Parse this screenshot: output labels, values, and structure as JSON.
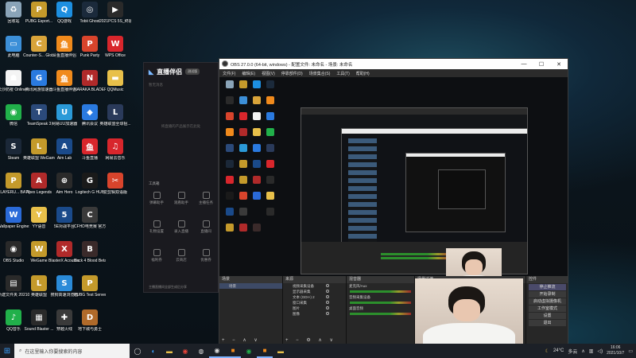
{
  "desktop": {
    "icons": [
      {
        "label": "回收站",
        "icon": "recycle-bin-icon",
        "color": "#8aa4b8",
        "glyph": "♻"
      },
      {
        "label": "PUBG Esport...",
        "icon": "pubg-esports-icon",
        "color": "#c49a2b",
        "glyph": "P"
      },
      {
        "label": "QQ游戏",
        "icon": "qq-game-icon",
        "color": "#1d8fe0",
        "glyph": "Q"
      },
      {
        "label": "Tobii Ghost",
        "icon": "tobii-ghost-icon",
        "color": "#1b2a3b",
        "glyph": "◎"
      },
      {
        "label": "2021PCS 5S_终极赛...",
        "icon": "video-file-icon",
        "color": "#2a2a2a",
        "glyph": "▶"
      },
      {
        "label": "此电脑",
        "icon": "this-pc-icon",
        "color": "#3c8fd8",
        "glyph": "▭"
      },
      {
        "label": "Counter-S... Global Off...",
        "icon": "csgo-icon",
        "color": "#d9a43a",
        "glyph": "C"
      },
      {
        "label": "斗鱼直播伴侣",
        "icon": "douyu-icon",
        "color": "#f08a1c",
        "glyph": "鱼"
      },
      {
        "label": "Punk Party",
        "icon": "punk-party-icon",
        "color": "#d8442c",
        "glyph": "P"
      },
      {
        "label": "WPS Office",
        "icon": "wps-office-icon",
        "color": "#d8262c",
        "glyph": "W"
      },
      {
        "label": "长沙防疫 Online...",
        "icon": "runner-icon",
        "color": "#f4f4f4",
        "glyph": "☗"
      },
      {
        "label": "腾讯网游加速器",
        "icon": "tencent-accelerator-icon",
        "color": "#2a7ae0",
        "glyph": "G"
      },
      {
        "label": "斗鱼直播伴侣",
        "icon": "douyu-2-icon",
        "color": "#f08a1c",
        "glyph": "鱼"
      },
      {
        "label": "NARAKA BLADEPOI...",
        "icon": "naraka-icon",
        "color": "#b02a2a",
        "glyph": "N"
      },
      {
        "label": "QQMusic",
        "icon": "folder-icon",
        "color": "#e8c04a",
        "glyph": "▬"
      },
      {
        "label": "微信",
        "icon": "wechat-icon",
        "color": "#21b04a",
        "glyph": "◉"
      },
      {
        "label": "TeamSpeak 3",
        "icon": "teamspeak-icon",
        "color": "#2b4a7a",
        "glyph": "T"
      },
      {
        "label": "网易UU加速器",
        "icon": "uu-accelerator-icon",
        "color": "#2b9ad8",
        "glyph": "U"
      },
      {
        "label": "腾讯会议",
        "icon": "tencent-meeting-icon",
        "color": "#2a7ae0",
        "glyph": "◆"
      },
      {
        "label": "英雄联盟全球狙...",
        "icon": "league-icon",
        "color": "#2a3a5a",
        "glyph": "L"
      },
      {
        "label": "Steam",
        "icon": "steam-icon",
        "color": "#1b2838",
        "glyph": "S"
      },
      {
        "label": "英雄联盟 WeGame版",
        "icon": "wegame-lol-icon",
        "color": "#c49a2b",
        "glyph": "L"
      },
      {
        "label": "Aim Lab",
        "icon": "aim-lab-icon",
        "color": "#1a4a8a",
        "glyph": "A"
      },
      {
        "label": "斗鱼直播",
        "icon": "douyu-live-icon",
        "color": "#d8262c",
        "glyph": "鱼"
      },
      {
        "label": "网易云音乐",
        "icon": "netease-music-icon",
        "color": "#d8262c",
        "glyph": "♫"
      },
      {
        "label": "PLAYERU... BATTLEGR...",
        "icon": "pubg-icon",
        "color": "#c49a2b",
        "glyph": "P"
      },
      {
        "label": "Apex Legends",
        "icon": "apex-icon",
        "color": "#b02a2a",
        "glyph": "A"
      },
      {
        "label": "Aim Hero",
        "icon": "aim-hero-icon",
        "color": "#2a2a2a",
        "glyph": "⊕"
      },
      {
        "label": "Logitech G HUB",
        "icon": "logitech-icon",
        "color": "#1a1a1a",
        "glyph": "G"
      },
      {
        "label": "爱剪辑双语版",
        "icon": "video-editor-icon",
        "color": "#d8442c",
        "glyph": "✂"
      },
      {
        "label": "Wallpaper Engine:...",
        "icon": "wallpaper-engine-icon",
        "color": "#2a6ad8",
        "glyph": "W"
      },
      {
        "label": "YY语音",
        "icon": "yy-icon",
        "color": "#e8c04a",
        "glyph": "Y"
      },
      {
        "label": "5E对战平台",
        "icon": "5e-icon",
        "color": "#1a4a8a",
        "glyph": "5"
      },
      {
        "label": "CFHD电竞赛 官方版",
        "icon": "cfhd-icon",
        "color": "#3a3a3a",
        "glyph": "C"
      },
      {
        "label": "",
        "icon": "blank-icon",
        "color": "rgba(0,0,0,0)",
        "glyph": ""
      },
      {
        "label": "OBS Studio",
        "icon": "obs-icon",
        "color": "#2a2a2a",
        "glyph": "◉"
      },
      {
        "label": "WeGame",
        "icon": "wegame-icon",
        "color": "#c49a2b",
        "glyph": "W"
      },
      {
        "label": "BlasterX Acoustic...",
        "icon": "blasterx-icon",
        "color": "#b02a2a",
        "glyph": "X"
      },
      {
        "label": "Back 4 Blood Beta",
        "icon": "back4blood-icon",
        "color": "#3a2a2a",
        "glyph": "B"
      },
      {
        "label": "",
        "icon": "blank-2-icon",
        "color": "rgba(0,0,0,0)",
        "glyph": ""
      },
      {
        "label": "新建文件夹 2021031...",
        "icon": "new-folder-icon",
        "color": "#2a2a2a",
        "glyph": "▤"
      },
      {
        "label": "英雄联盟",
        "icon": "lol-icon",
        "color": "#c49a2b",
        "glyph": "L"
      },
      {
        "label": "搜狗高速浏览器",
        "icon": "sogou-browser-icon",
        "color": "#2a8ad8",
        "glyph": "S"
      },
      {
        "label": "PUBG Test Server",
        "icon": "pubg-test-icon",
        "color": "#c49a2b",
        "glyph": "P"
      },
      {
        "label": "",
        "icon": "blank-3-icon",
        "color": "rgba(0,0,0,0)",
        "glyph": ""
      },
      {
        "label": "QQ音乐",
        "icon": "qq-music-icon",
        "color": "#21b04a",
        "glyph": "♪"
      },
      {
        "label": "Sound Blaster ...",
        "icon": "sound-blaster-icon",
        "color": "#2a2a2a",
        "glyph": "▦"
      },
      {
        "label": "穿越火线",
        "icon": "crossfire-icon",
        "color": "#3a3a3a",
        "glyph": "✚"
      },
      {
        "label": "地下城与勇士",
        "icon": "dnf-icon",
        "color": "#b06a2a",
        "glyph": "D"
      }
    ]
  },
  "obs": {
    "title": "OBS 27.0.0 (64-bit, windows) - 配置文件: 未命名 - 场景: 未命名",
    "menu": [
      "文件(F)",
      "编辑(E)",
      "视图(V)",
      "停靠部件(D)",
      "场景集合(S)",
      "工具(T)",
      "帮助(H)"
    ],
    "docks": {
      "scenes_header": "场景",
      "scene_items": [
        "场景"
      ],
      "sources_header": "来源",
      "source_items": [
        "视频采集设备",
        "显示器采集",
        "文本 (GDI+) 2",
        "窗口采集",
        "图片",
        "图像"
      ],
      "mixer_header": "混音器",
      "mixer_items": [
        "麦克风/Aux",
        "音频采集设备",
        "桌面音频"
      ],
      "transitions_header": "场景过渡",
      "controls_header": "控件",
      "controls": [
        "停止推流",
        "开始录制",
        "启动虚拟摄像机",
        "工作室模式",
        "设置",
        "退出"
      ]
    },
    "filter_label": "来选择源"
  },
  "zhibo": {
    "title": "直播伴侣",
    "badge": "测试版",
    "subtitle": "暂无消息",
    "placeholder": "将直播的产品展示在此处",
    "section": "工具箱",
    "tools": [
      "弹幕助手",
      "观看助手",
      "主播任务",
      "礼物设置",
      "录入直播",
      "直播间",
      "福利券",
      "云商店",
      "优惠券"
    ],
    "footer": "主播直播间全部生成后分享"
  },
  "taskbar": {
    "search_placeholder": "在这里输入你要搜索的内容",
    "weather": "24°C",
    "weather_text": "多云",
    "time": "16:06",
    "date": "2021/10/7"
  }
}
